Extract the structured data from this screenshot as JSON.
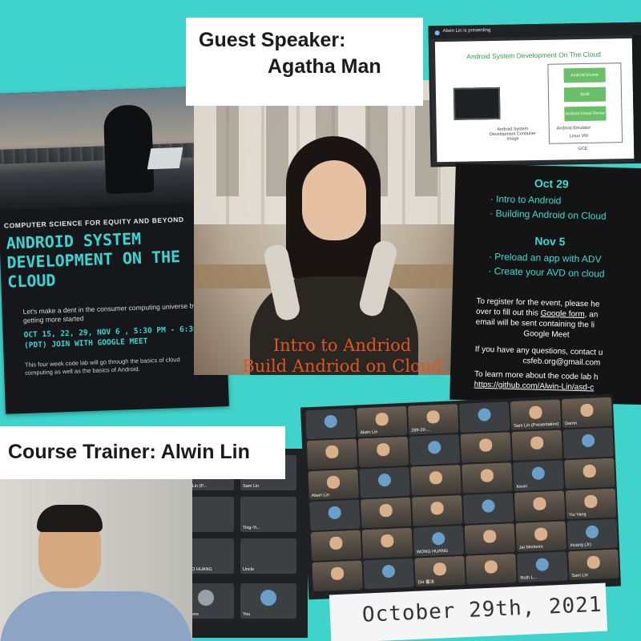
{
  "poster": {
    "org": "COMPUTER SCIENCE FOR EQUITY AND BEYOND",
    "title": "ANDROID SYSTEM DEVELOPMENT ON THE CLOUD",
    "tagline": "Let's make a dent in the consumer computing universe by getting more started",
    "dates": "OCT 15, 22, 29, NOV 6 , 5:30 PM - 6:30 PM (PDT) JOIN WITH GOOGLE MEET",
    "description": "This four week code lab will go through the basics of cloud computing as well as the basics of Android."
  },
  "guest": {
    "line1": "Guest Speaker:",
    "line2": "Agatha Man"
  },
  "caption": {
    "line1": "Intro to Andriod",
    "line2": "Build Andriod on Cloud"
  },
  "slide": {
    "presenting": "Alwin Lin is presenting",
    "title": "Android System Development On The Cloud",
    "box1": "Android Source",
    "box2": "Build",
    "box3": "Android Virtual Device Image",
    "emulator": "Android Emulator",
    "linux_vm": "Linux VM",
    "gce": "GCE",
    "container": "Android System Development Container Image"
  },
  "schedule": {
    "oct_heading": "Oct 29",
    "oct_items": [
      "· Intro to Android",
      "· Building Android on Cloud"
    ],
    "nov_heading": "Nov 5",
    "nov_items": [
      "· Preload an app with ADV",
      "· Create your AVD on cloud"
    ],
    "register_1": "To register for the event, please he",
    "register_2a": "over to fill out this ",
    "register_link": "Google form",
    "register_2b": ", an",
    "register_3": "email will be sent containing the li",
    "register_4": "Google Meet",
    "questions": "If you have any questions, contact u",
    "email": "csfeb.org@gmail.com",
    "learn": "To learn more about the code lab h",
    "github": "https://github.com/Alwin-Lin/asd-c"
  },
  "trainer": {
    "label": "Course Trainer: Alwin Lin",
    "tiles": [
      "Alwin Lin (P...",
      "Sam Lin",
      "",
      "Ting-Yi...",
      "",
      "Jung...",
      "WEIBO HUANG",
      "Uncle",
      "15 others",
      "You"
    ]
  },
  "meet": {
    "tiles": [
      "",
      "Alwin Lin",
      "289-20-...",
      "",
      "Sam Lin (Presentation)",
      "Darrin",
      "",
      "",
      "",
      "",
      "",
      "",
      "Alwin Lin",
      "",
      "",
      "",
      "Kevin",
      "",
      "",
      "",
      "",
      "",
      "",
      "Yui Yang",
      "",
      "",
      "WONG HUANG",
      "",
      "Jai Monteiro",
      "Huang (Jr)",
      "",
      "",
      "DH 書法",
      "",
      "Ruth L...",
      "Sam Lin",
      "You",
      ""
    ]
  },
  "date": "October 29th, 2021"
}
